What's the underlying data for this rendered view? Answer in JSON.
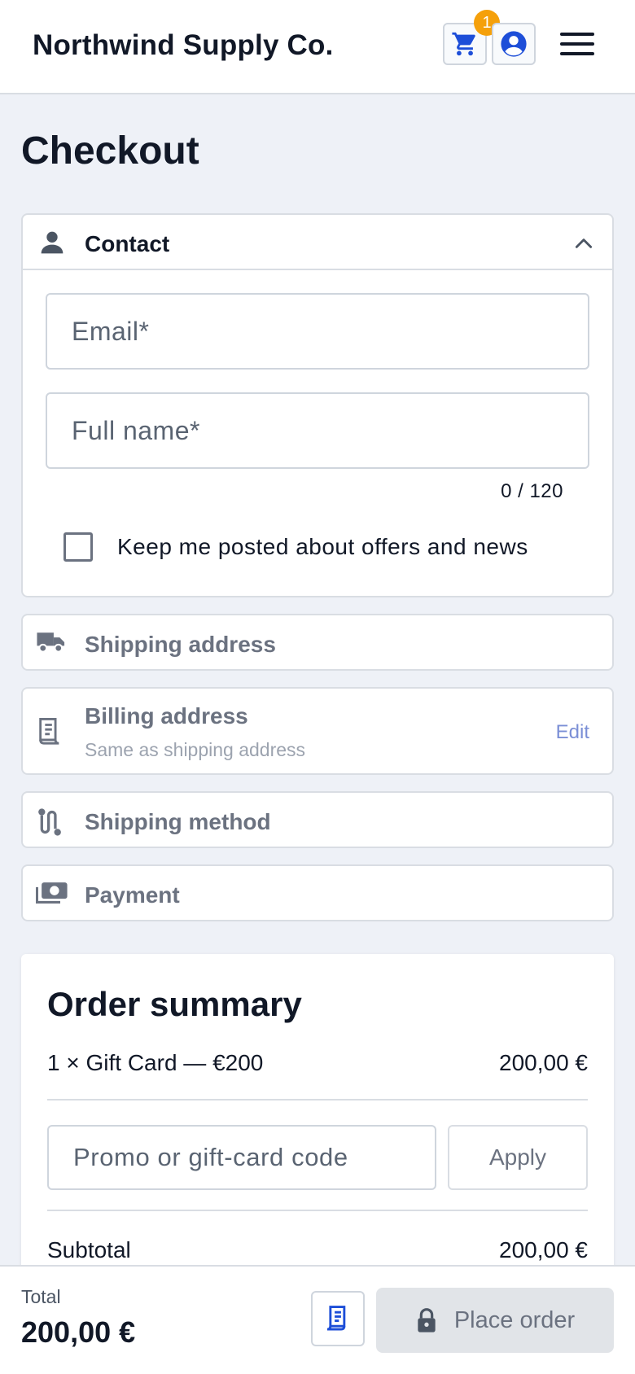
{
  "header": {
    "brand": "Northwind Supply Co.",
    "cart_count": "1",
    "icons": [
      "cart-icon",
      "account-icon",
      "menu-icon"
    ]
  },
  "page": {
    "title": "Checkout"
  },
  "contact": {
    "title": "Contact",
    "email_placeholder": "Email*",
    "email_value": "",
    "name_placeholder": "Full name*",
    "name_value": "",
    "char_count": "0 / 120",
    "newsletter_label": "Keep me posted about offers and news",
    "newsletter_checked": false
  },
  "sections": {
    "shipping_address": "Shipping address",
    "billing_address": "Billing address",
    "billing_sub": "Same as shipping address",
    "billing_edit": "Edit",
    "shipping_method": "Shipping method",
    "payment": "Payment"
  },
  "summary": {
    "title": "Order summary",
    "item": "1 × Gift Card — €200",
    "item_price": "200,00 €",
    "promo_placeholder": "Promo or gift-card code",
    "apply_label": "Apply",
    "subtotal_label": "Subtotal",
    "subtotal_value": "200,00 €"
  },
  "footer": {
    "total_label": "Total",
    "total_value": "200,00 €",
    "place_order_label": "Place order"
  },
  "colors": {
    "accent": "#1d4ed8",
    "badge": "#f5a00a",
    "link": "#7b8fd6",
    "page_bg": "#eef1f7"
  }
}
